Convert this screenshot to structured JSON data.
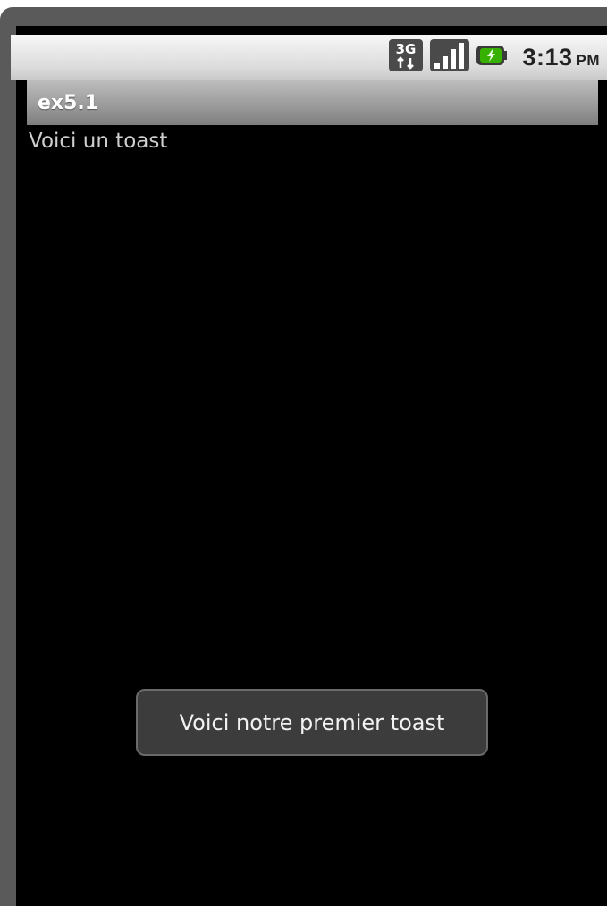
{
  "status_bar": {
    "icons": [
      "3g-data-icon",
      "signal-strength-icon",
      "battery-charging-icon"
    ],
    "network_label": "3G",
    "time": "3:13",
    "ampm": "PM"
  },
  "app": {
    "title": "ex5.1",
    "body_text": "Voici un toast"
  },
  "toast": {
    "message": "Voici notre premier toast"
  },
  "colors": {
    "screen_background": "#000000",
    "title_bar": "#9c9c9c",
    "toast_background": "#3c3c3c",
    "battery_green": "#38b000"
  }
}
